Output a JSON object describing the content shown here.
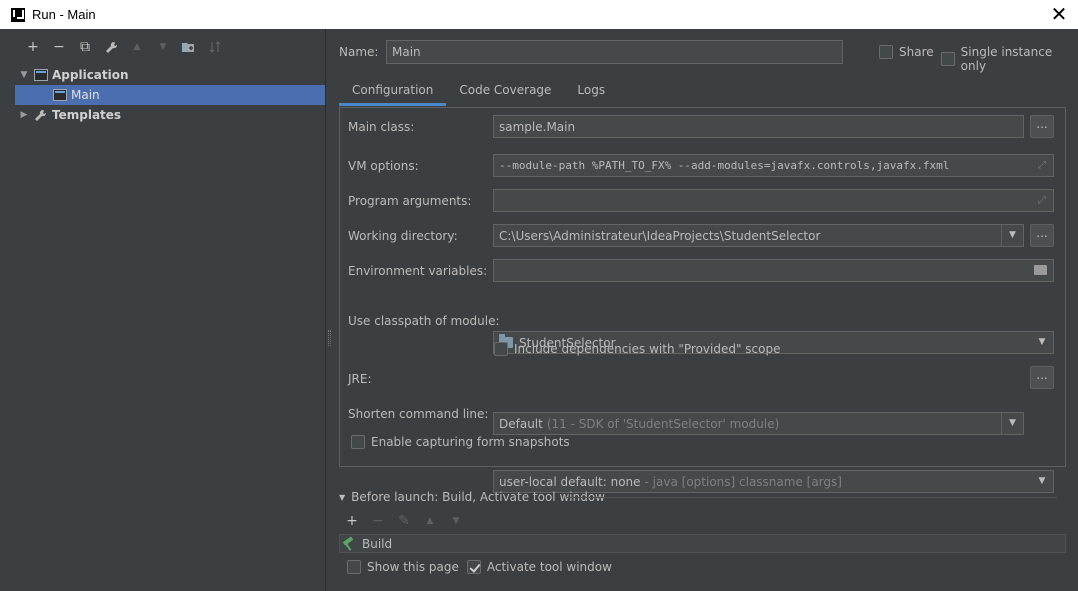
{
  "window": {
    "title": "Run - Main",
    "close_glyph": "✕"
  },
  "left": {
    "toolbar": [
      {
        "name": "add-icon",
        "glyph": "+",
        "enabled": true
      },
      {
        "name": "remove-icon",
        "glyph": "−",
        "enabled": true
      },
      {
        "name": "copy-icon",
        "glyph": "⧉",
        "enabled": true
      },
      {
        "name": "wrench-icon",
        "glyph": "🔧",
        "enabled": true
      },
      {
        "name": "move-up-icon",
        "glyph": "▲",
        "enabled": false
      },
      {
        "name": "move-down-icon",
        "glyph": "▼",
        "enabled": false
      },
      {
        "name": "new-folder-icon",
        "glyph": "▣",
        "enabled": true
      },
      {
        "name": "sort-icon",
        "glyph": "⇅",
        "enabled": false
      }
    ],
    "tree": {
      "application": "Application",
      "main": "Main",
      "templates": "Templates"
    }
  },
  "form": {
    "name_label": "Name:",
    "name_value": "Main",
    "share_label": "Share",
    "single_instance_label": "Single instance only",
    "tabs": [
      "Configuration",
      "Code Coverage",
      "Logs"
    ],
    "main_class_label": "Main class:",
    "main_class_value": "sample.Main",
    "vm_options_label": "VM options:",
    "vm_options_value": "--module-path %PATH_TO_FX% --add-modules=javafx.controls,javafx.fxml",
    "program_args_label": "Program arguments:",
    "program_args_value": "",
    "working_dir_label": "Working directory:",
    "working_dir_value": "C:\\Users\\Administrateur\\IdeaProjects\\StudentSelector",
    "env_vars_label": "Environment variables:",
    "env_vars_value": "",
    "classpath_label": "Use classpath of module:",
    "classpath_value": "StudentSelector",
    "include_deps_label": "Include dependencies with \"Provided\" scope",
    "jre_label": "JRE:",
    "jre_value": "Default",
    "jre_hint": "(11 - SDK of 'StudentSelector' module)",
    "shorten_label": "Shorten command line:",
    "shorten_value": "user-local default: none",
    "shorten_hint": "- java [options] classname [args]",
    "snapshots_label": "Enable capturing form snapshots",
    "dots": "..."
  },
  "before_launch": {
    "header": "Before launch: Build, Activate tool window",
    "item": "Build",
    "show_page_label": "Show this page",
    "activate_label": "Activate tool window"
  }
}
